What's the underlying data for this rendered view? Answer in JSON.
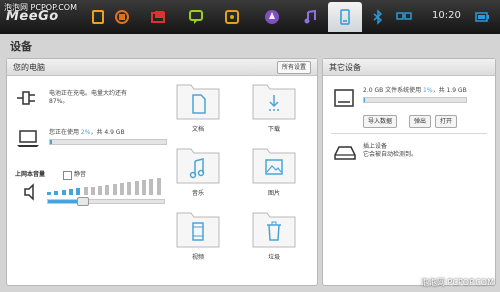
{
  "topbar": {
    "brand": "MeeGo",
    "clock": "10:20"
  },
  "watermark": {
    "top": "泡泡网 PCPOP.COM",
    "bottom": "泡泡网 PCPOP.COM"
  },
  "page": {
    "title": "设备"
  },
  "left_panel": {
    "title": "您的电脑",
    "all_settings": "所有设置",
    "battery": {
      "line1": "电池正在充电。电量大约还有",
      "line2": "87%。"
    },
    "storage": {
      "prefix": "您正在使用 ",
      "percent": "2%",
      "suffix": "，共 4.9 GB",
      "fraction": 0.02
    },
    "volume": {
      "label": "上网本音量",
      "mute_label": "静音",
      "level": 0.3
    },
    "folders": [
      {
        "label": "文档",
        "icon": "document-icon"
      },
      {
        "label": "下载",
        "icon": "download-icon"
      },
      {
        "label": "音乐",
        "icon": "music-icon"
      },
      {
        "label": "图片",
        "icon": "picture-icon"
      },
      {
        "label": "视频",
        "icon": "video-icon"
      },
      {
        "label": "垃圾",
        "icon": "trash-icon"
      }
    ]
  },
  "right_panel": {
    "title": "其它设备",
    "fs": {
      "prefix": "2.0 GB 文件系统使用 ",
      "percent": "1%",
      "suffix": "，共 1.9 GB",
      "fraction": 0.01
    },
    "buttons": {
      "import": "导入数据",
      "eject": "弹出",
      "open": "打开"
    },
    "plug": {
      "line1": "插上设备",
      "line2": "它会被自动检测到。"
    }
  },
  "colors": {
    "accent": "#4aa3d8"
  }
}
